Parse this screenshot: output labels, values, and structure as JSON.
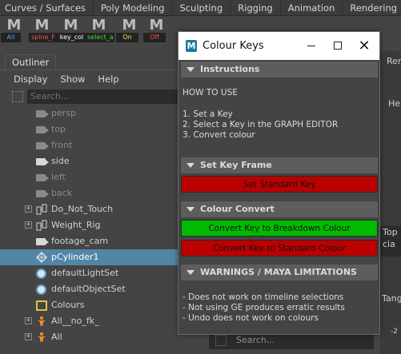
{
  "menu_tabs": [
    "Curves / Surfaces",
    "Poly Modeling",
    "Sculpting",
    "Rigging",
    "Animation",
    "Rendering"
  ],
  "shelf": [
    {
      "glyph": "M",
      "label": "All",
      "color": "#4a9cff"
    },
    {
      "glyph": "M",
      "label": "spine_F",
      "color": "#ff4d4d"
    },
    {
      "glyph": "M",
      "label": "key_col",
      "color": "#ffffff"
    },
    {
      "glyph": "M",
      "label": "select_a",
      "color": "#3ddc3d"
    },
    {
      "glyph": "M",
      "label": "On",
      "color": "#f2e24a"
    },
    {
      "glyph": "M",
      "label": "Off",
      "color": "#ff4d4d"
    }
  ],
  "outliner": {
    "tab": "Outliner",
    "menu": [
      "Display",
      "Show",
      "Help"
    ],
    "search_placeholder": "Search...",
    "items": [
      {
        "label": "persp",
        "icon": "camera-icon",
        "dim": true
      },
      {
        "label": "top",
        "icon": "camera-icon",
        "dim": true
      },
      {
        "label": "front",
        "icon": "camera-icon",
        "dim": true
      },
      {
        "label": "side",
        "icon": "camera-icon",
        "dim": false
      },
      {
        "label": "left",
        "icon": "camera-icon",
        "dim": true
      },
      {
        "label": "back",
        "icon": "camera-icon",
        "dim": true
      },
      {
        "label": "Do_Not_Touch",
        "icon": "group-icon",
        "expand": true
      },
      {
        "label": "Weight_Rig",
        "icon": "group-icon",
        "expand": true
      },
      {
        "label": "footage_cam",
        "icon": "camera-icon",
        "dim": false
      },
      {
        "label": "pCylinder1",
        "icon": "mesh-icon",
        "selected": true
      },
      {
        "label": "defaultLightSet",
        "icon": "set-icon"
      },
      {
        "label": "defaultObjectSet",
        "icon": "set-icon"
      },
      {
        "label": "Colours",
        "icon": "colours-icon"
      },
      {
        "label": "All__no_fk_",
        "icon": "character-icon",
        "expand": true
      },
      {
        "label": "All",
        "icon": "character-icon",
        "expand": true
      }
    ]
  },
  "background": {
    "partial_texts": [
      "Ren",
      "He",
      "Top",
      "cia",
      "Tang",
      "-2"
    ],
    "search_placeholder": "Search..."
  },
  "colour_keys": {
    "title": "Colour Keys",
    "logo": "M",
    "sections": {
      "instructions": "Instructions",
      "set_key_frame": "Set Key Frame",
      "colour_convert": "Colour Convert",
      "warnings": "WARNINGS / MAYA LIMITATIONS"
    },
    "how_to_use": "HOW TO USE",
    "steps": [
      "1. Set a Key",
      "2. Select a Key in the GRAPH EDITOR",
      "3. Convert colour"
    ],
    "buttons": {
      "set_standard_key": "Set Standard Key",
      "convert_breakdown": "Convert Key to Breakdown Colour",
      "convert_standard": "Convert Key to Standard Colour"
    },
    "warnings": [
      "- Does not work on timeline selections",
      "- Not using GE produces erratic results",
      "- Undo does not work on colours"
    ]
  },
  "colors": {
    "button_red": "#bb0000",
    "button_green": "#00bb00",
    "selection": "#5285a6"
  }
}
